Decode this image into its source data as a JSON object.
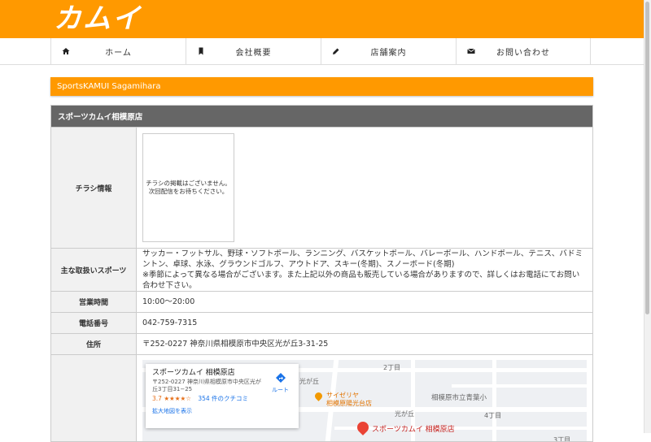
{
  "header": {
    "logo_text": "カムイ",
    "brand_color": "#ff9900"
  },
  "nav": {
    "items": [
      {
        "label": "ホーム",
        "icon": "home-icon"
      },
      {
        "label": "会社概要",
        "icon": "bookmark-icon"
      },
      {
        "label": "店舗案内",
        "icon": "pencil-icon"
      },
      {
        "label": "お問い合わせ",
        "icon": "envelope-icon"
      }
    ]
  },
  "page": {
    "section_title": "SportsKAMUI Sagamihara"
  },
  "store": {
    "name": "スポーツカムイ相模原店",
    "rows": {
      "flyer_label": "チラシ情報",
      "flyer_text_1": "チラシの掲載はございません。",
      "flyer_text_2": "次回配信をお待ちください。",
      "sports_label": "主な取扱いスポーツ",
      "sports_text": "サッカー・フットサル、野球・ソフトボール、ランニング、バスケットボール、バレーボール、ハンドボール、テニス、バドミントン、卓球、水泳、グラウンドゴルフ、アウトドア、スキー(冬期)、スノーボード(冬期)",
      "sports_note": "※季節によって異なる場合がございます。また上記以外の商品も販売している場合がありますので、詳しくはお電話にてお問い合わせ下さい。",
      "hours_label": "営業時間",
      "hours_value": "10:00〜20:00",
      "phone_label": "電話番号",
      "phone_value": "042-759-7315",
      "address_label": "住所",
      "address_value": "〒252-0227 神奈川県相模原市中央区光が丘3-31-25"
    }
  },
  "map": {
    "card_title": "スポーツカムイ 相模原店",
    "card_address": "〒252-0227 神奈川県相模原市中央区光が丘3丁目31−25",
    "rating": "3.7",
    "stars": "★★★★☆",
    "review_count": "354 件のクチコミ",
    "enlarge_link": "拡大地図を表示",
    "route_label": "ルート",
    "labels": {
      "hikarigaoka": "光が丘",
      "choume2": "2丁目",
      "school": "相模原市立青葉小",
      "saizeriya_1": "サイゼリヤ",
      "saizeriya_2": "相模原陽光台店",
      "hikarigaoka2": "光が丘",
      "choume4": "4丁目",
      "choume3": "3丁目",
      "pin_label": "スポーツカムイ 相模原店"
    }
  }
}
